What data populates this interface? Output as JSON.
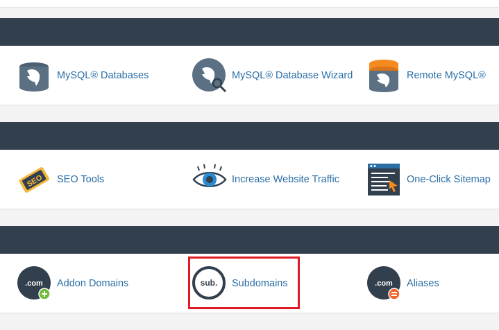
{
  "sections": [
    {
      "items": [
        {
          "label": "MySQL® Databases",
          "icon": "mysql-databases-icon"
        },
        {
          "label": "MySQL® Database Wizard",
          "icon": "mysql-database-wizard-icon"
        },
        {
          "label": "Remote MySQL®",
          "icon": "remote-mysql-icon"
        }
      ]
    },
    {
      "items": [
        {
          "label": "SEO Tools",
          "icon": "seo-tools-icon"
        },
        {
          "label": "Increase Website Traffic",
          "icon": "increase-traffic-icon"
        },
        {
          "label": "One-Click Sitemap",
          "icon": "sitemap-icon"
        }
      ]
    },
    {
      "items": [
        {
          "label": "Addon Domains",
          "icon": "addon-domains-icon"
        },
        {
          "label": "Subdomains",
          "icon": "subdomains-icon",
          "highlighted": true
        },
        {
          "label": "Aliases",
          "icon": "aliases-icon"
        }
      ]
    }
  ],
  "icon_text": {
    "seo": "SEO",
    "dot_com": ".com",
    "sub": "sub."
  },
  "colors": {
    "header_bg": "#323f4d",
    "link": "#2a6ea6",
    "highlight": "#e01b24",
    "mysql_blue": "#5b7183",
    "remote_orange": "#f58a1f",
    "seo_yellow": "#f5b83d",
    "addon_green": "#6fba3b",
    "alias_orange": "#f0672f"
  }
}
